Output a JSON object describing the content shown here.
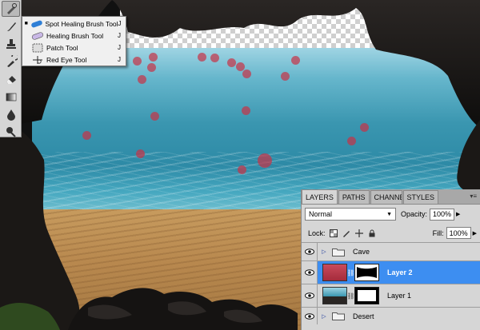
{
  "tools_panel": {
    "tools": [
      {
        "icon": "spot-healing-brush-icon",
        "selected": true
      },
      {
        "icon": "brush-icon"
      },
      {
        "icon": "clone-stamp-icon"
      },
      {
        "icon": "history-brush-icon"
      },
      {
        "icon": "eraser-icon"
      },
      {
        "icon": "gradient-icon"
      },
      {
        "icon": "blur-icon"
      },
      {
        "icon": "dodge-icon"
      }
    ]
  },
  "flyout_menu": {
    "items": [
      {
        "label": "Spot Healing Brush Tool",
        "shortcut": "J",
        "icon": "spot-healing-brush-icon",
        "selected": true
      },
      {
        "label": "Healing Brush Tool",
        "shortcut": "J",
        "icon": "healing-brush-icon"
      },
      {
        "label": "Patch Tool",
        "shortcut": "J",
        "icon": "patch-icon"
      },
      {
        "label": "Red Eye Tool",
        "shortcut": "J",
        "icon": "red-eye-icon"
      }
    ]
  },
  "layers_panel": {
    "tabs": [
      "LAYERS",
      "PATHS",
      "CHANNE",
      "STYLES"
    ],
    "active_tab": "LAYERS",
    "blend_mode": "Normal",
    "opacity_label": "Opacity:",
    "opacity_value": "100%",
    "lock_label": "Lock:",
    "fill_label": "Fill:",
    "fill_value": "100%",
    "layers": [
      {
        "name": "Cave",
        "type": "group",
        "visible": true
      },
      {
        "name": "Layer 2",
        "type": "layer",
        "visible": true,
        "selected": true
      },
      {
        "name": "Layer 1",
        "type": "layer",
        "visible": true
      },
      {
        "name": "Desert",
        "type": "group",
        "visible": true
      }
    ]
  },
  "colors": {
    "selection_blue": "#3d8ef1",
    "panel_gray": "#d6d6d6",
    "dot_red": "#c83246"
  }
}
